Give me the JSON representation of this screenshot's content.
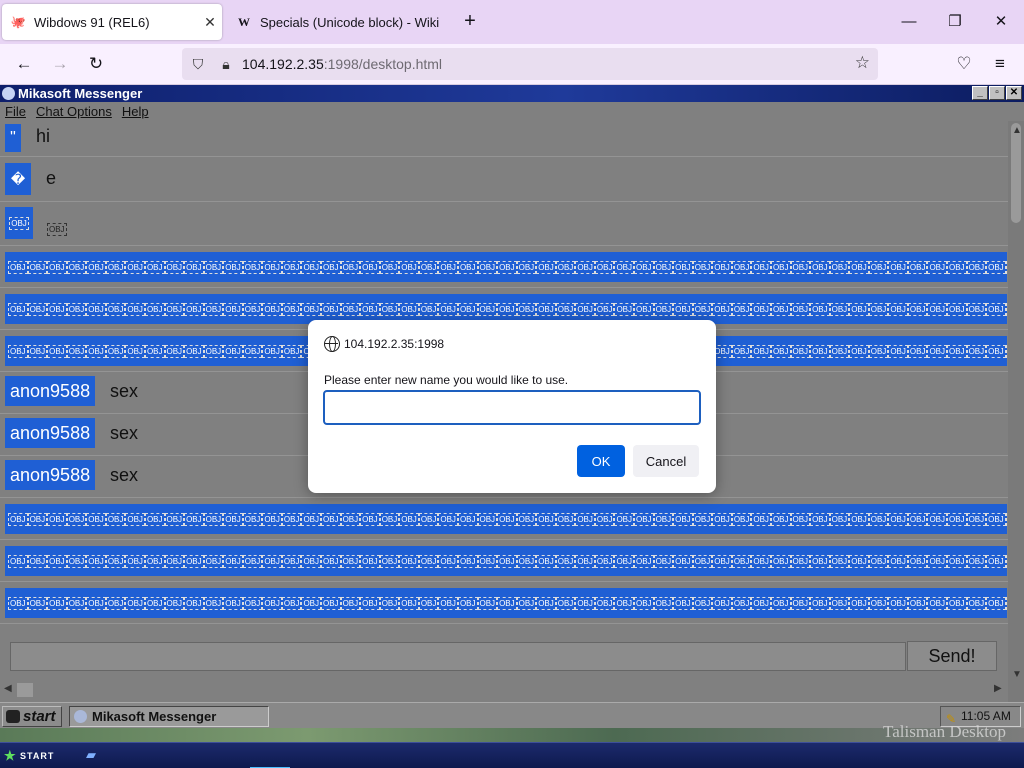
{
  "browser": {
    "tabs": [
      {
        "label": "Wibdows 91 (REL6)",
        "active": true
      },
      {
        "label": "Specials (Unicode block) - Wiki",
        "active": false
      }
    ],
    "url_host": "104.192.2.35",
    "url_path": ":1998/desktop.html"
  },
  "messenger": {
    "title": "Mikasoft Messenger",
    "menu": [
      "File",
      "Chat Options",
      "Help"
    ],
    "messages": [
      {
        "badge": "\"",
        "text": "hi"
      },
      {
        "badge": "�",
        "text": "e"
      },
      {
        "badge": "OBJ",
        "text": "OBJ"
      },
      {
        "badge": "anon9588",
        "text": "sex"
      },
      {
        "badge": "anon9588",
        "text": "sex"
      },
      {
        "badge": "anon9588",
        "text": "sex"
      }
    ],
    "obj_glyph": "OBJ",
    "send_label": "Send!",
    "composer_value": ""
  },
  "w93_taskbar": {
    "start_label": "start",
    "task_label": "Mikasoft Messenger",
    "clock": "11:05 AM",
    "desktop_label": "Talisman Desktop"
  },
  "os_taskbar": {
    "start_label": "START"
  },
  "dialog": {
    "origin": "104.192.2.35:1998",
    "message": "Please enter new name you would like to use.",
    "input_value": "",
    "ok_label": "OK",
    "cancel_label": "Cancel"
  },
  "colors": {
    "badge_blue": "#1f5fd4",
    "ok_blue": "#0061e0",
    "tabbar": "#e8d5f5"
  }
}
